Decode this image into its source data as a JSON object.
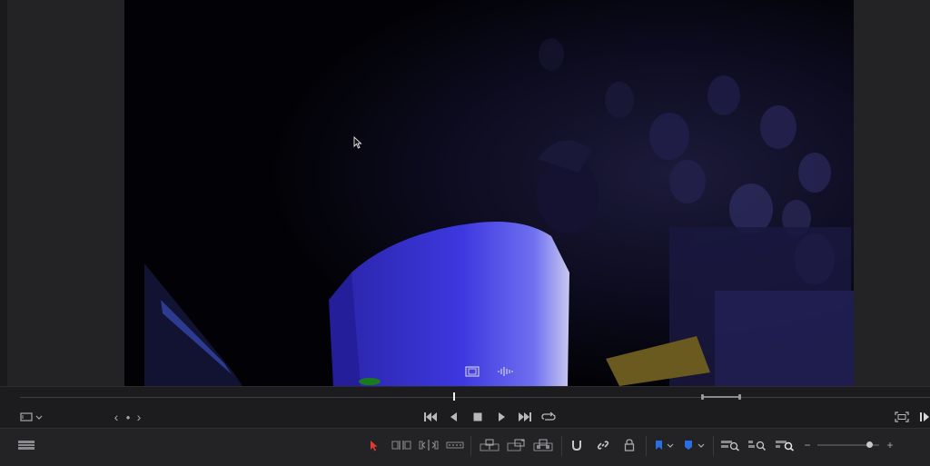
{
  "viewer": {
    "clip_view_icon": "film-strip-icon",
    "audio_view_icon": "audio-waveform-icon"
  },
  "transport": {
    "viewer_mode_icon": "viewer-mode-icon",
    "nav_prev": "‹",
    "nav_dot": "●",
    "nav_next": "›",
    "buttons": [
      "skip-to-start-icon",
      "play-reverse-icon",
      "stop-icon",
      "play-icon",
      "skip-to-end-icon",
      "loop-icon"
    ],
    "right_icons": [
      "fullscreen-icon",
      "next-frame-icon"
    ]
  },
  "toolbar": {
    "tools": [
      "timeline-view-options-icon",
      "selection-arrow-icon",
      "trim-edit-icon",
      "dynamic-trim-icon",
      "blade-icon",
      "insert-clip-icon",
      "overwrite-clip-icon",
      "replace-clip-icon",
      "snapping-icon",
      "linked-selection-icon",
      "position-lock-icon",
      "flag-icon",
      "marker-icon",
      "zoom-full-icon",
      "zoom-detail-icon",
      "zoom-custom-icon"
    ],
    "zoom_minus": "−",
    "zoom_plus": "+",
    "zoom_level": 0.85
  },
  "colors": {
    "selection_tool": "#e23a32",
    "flag_blue": "#2a6ee6",
    "marker_blue": "#2a6ee6",
    "jersey_blue": "#3b35d8"
  }
}
